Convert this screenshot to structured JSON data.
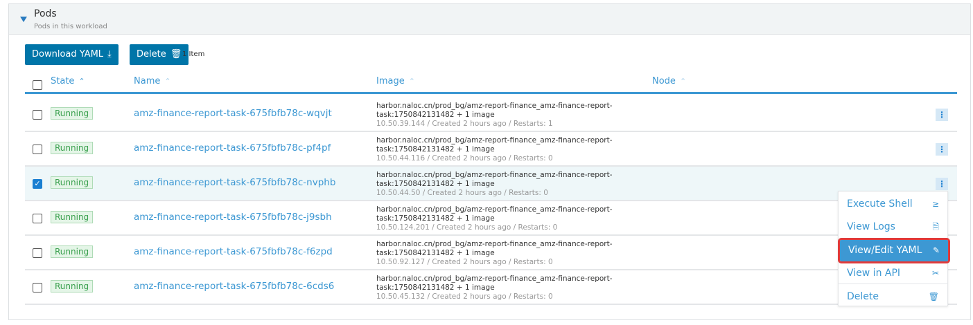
{
  "section": {
    "title": "Pods",
    "subtitle": "Pods in this workload"
  },
  "toolbar": {
    "download_label": "Download YAML",
    "delete_label": "Delete",
    "count": "1 Item"
  },
  "columns": {
    "state": "State",
    "name": "Name",
    "image": "Image",
    "node": "Node"
  },
  "rows": [
    {
      "state": "Running",
      "name": "amz-finance-report-task-675fbfb78c-wqvjt",
      "image1": "harbor.naloc.cn/prod_bg/amz-report-finance_amz-finance-report-",
      "image2": "task:1750842131482 + 1 image",
      "meta": "10.50.39.144 / Created 2 hours ago / Restarts: 1",
      "checked": false
    },
    {
      "state": "Running",
      "name": "amz-finance-report-task-675fbfb78c-pf4pf",
      "image1": "harbor.naloc.cn/prod_bg/amz-report-finance_amz-finance-report-",
      "image2": "task:1750842131482 + 1 image",
      "meta": "10.50.44.116 / Created 2 hours ago / Restarts: 0",
      "checked": false
    },
    {
      "state": "Running",
      "name": "amz-finance-report-task-675fbfb78c-nvphb",
      "image1": "harbor.naloc.cn/prod_bg/amz-report-finance_amz-finance-report-",
      "image2": "task:1750842131482 + 1 image",
      "meta": "10.50.44.50 / Created 2 hours ago / Restarts: 0",
      "checked": true
    },
    {
      "state": "Running",
      "name": "amz-finance-report-task-675fbfb78c-j9sbh",
      "image1": "harbor.naloc.cn/prod_bg/amz-report-finance_amz-finance-report-",
      "image2": "task:1750842131482 + 1 image",
      "meta": "10.50.124.201 / Created 2 hours ago / Restarts: 0",
      "checked": false
    },
    {
      "state": "Running",
      "name": "amz-finance-report-task-675fbfb78c-f6zpd",
      "image1": "harbor.naloc.cn/prod_bg/amz-report-finance_amz-finance-report-",
      "image2": "task:1750842131482 + 1 image",
      "meta": "10.50.92.127 / Created 2 hours ago / Restarts: 0",
      "checked": false
    },
    {
      "state": "Running",
      "name": "amz-finance-report-task-675fbfb78c-6cds6",
      "image1": "harbor.naloc.cn/prod_bg/amz-report-finance_amz-finance-report-",
      "image2": "task:1750842131482 + 1 image",
      "meta": "10.50.45.132 / Created 2 hours ago / Restarts: 0",
      "checked": false
    }
  ],
  "menu": {
    "items": [
      {
        "label": "Execute Shell",
        "icon": "≥"
      },
      {
        "label": "View Logs",
        "icon": "🗎"
      },
      {
        "label": "View/Edit YAML",
        "icon": "✎"
      },
      {
        "label": "View in API",
        "icon": "✂"
      },
      {
        "label": "Delete",
        "icon": "🗑"
      }
    ]
  }
}
